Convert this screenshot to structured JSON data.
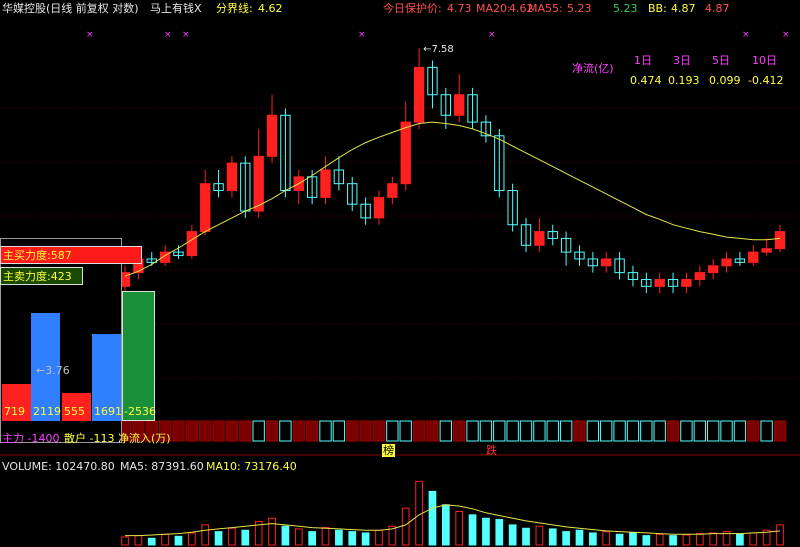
{
  "header": {
    "stock_name": "华媒控股(日线 前复权 对数)",
    "formula": "马上有钱X",
    "split_label": "分界线:",
    "split_value": "4.62",
    "protect_label": "今日保护价:",
    "protect_value": "4.73",
    "ma20_label": "MA20:",
    "ma20_value": "4.62",
    "ma55_label": "MA55:",
    "ma55_value": "5.23",
    "extra1": "5.23",
    "bb_label": "BB:",
    "bb_value": "4.87",
    "extra2": "4.87"
  },
  "netflow": {
    "title": "净流(亿)",
    "periods": [
      "1日",
      "3日",
      "5日",
      "10日"
    ],
    "values": [
      "0.474",
      "0.193",
      "0.099",
      "-0.412"
    ]
  },
  "force": {
    "buy_label": "主买力度:587",
    "sell_label": "主卖力度:423",
    "arrow_label": "←3.76",
    "bars": [
      {
        "label": "719",
        "value": 719,
        "color": "#ff2020"
      },
      {
        "label": "2119",
        "value": 2119,
        "color": "#2f7fff"
      },
      {
        "label": "555",
        "value": 555,
        "color": "#ff2020"
      },
      {
        "label": "1691",
        "value": 1691,
        "color": "#2f7fff"
      },
      {
        "label": "-2536",
        "value": 2536,
        "color": "#1a8f3a"
      }
    ],
    "bottom_main": "主力 -1400",
    "bottom_retail": "散户 -113",
    "bottom_net": "净流入(万)"
  },
  "markers": {
    "bang": "榜",
    "fall": "跌",
    "peak_label": "7.58"
  },
  "volume": {
    "title": "VOLUME: 102470.80",
    "ma5": "MA5: 87391.60",
    "ma10": "MA10: 73176.40"
  },
  "chart_data": {
    "type": "candlestick",
    "ma_line": [
      4.25,
      4.32,
      4.42,
      4.55,
      4.66,
      4.78,
      4.9,
      5.0,
      5.1,
      5.2,
      5.28,
      5.38,
      5.5,
      5.6,
      5.72,
      5.85,
      5.98,
      6.1,
      6.2,
      6.28,
      6.35,
      6.42,
      6.48,
      6.5,
      6.48,
      6.45,
      6.4,
      6.33,
      6.25,
      6.15,
      6.05,
      5.95,
      5.85,
      5.75,
      5.65,
      5.55,
      5.45,
      5.35,
      5.25,
      5.15,
      5.08,
      5.0,
      4.95,
      4.9,
      4.86,
      4.82,
      4.8,
      4.78,
      4.78,
      4.8
    ],
    "candles": [
      {
        "o": 4.1,
        "c": 4.3,
        "h": 4.4,
        "l": 4.0
      },
      {
        "o": 4.3,
        "c": 4.5,
        "h": 4.6,
        "l": 4.2
      },
      {
        "o": 4.5,
        "c": 4.45,
        "h": 4.6,
        "l": 4.4
      },
      {
        "o": 4.45,
        "c": 4.6,
        "h": 4.7,
        "l": 4.4
      },
      {
        "o": 4.6,
        "c": 4.55,
        "h": 4.7,
        "l": 4.5
      },
      {
        "o": 4.55,
        "c": 4.9,
        "h": 5.0,
        "l": 4.5
      },
      {
        "o": 4.9,
        "c": 5.6,
        "h": 5.8,
        "l": 4.85
      },
      {
        "o": 5.6,
        "c": 5.5,
        "h": 5.8,
        "l": 5.4
      },
      {
        "o": 5.5,
        "c": 5.9,
        "h": 6.0,
        "l": 5.4
      },
      {
        "o": 5.9,
        "c": 5.2,
        "h": 6.0,
        "l": 5.1
      },
      {
        "o": 5.2,
        "c": 6.0,
        "h": 6.4,
        "l": 5.1
      },
      {
        "o": 6.0,
        "c": 6.6,
        "h": 6.9,
        "l": 5.9
      },
      {
        "o": 6.6,
        "c": 5.5,
        "h": 6.7,
        "l": 5.4
      },
      {
        "o": 5.5,
        "c": 5.7,
        "h": 5.8,
        "l": 5.3
      },
      {
        "o": 5.7,
        "c": 5.4,
        "h": 5.8,
        "l": 5.3
      },
      {
        "o": 5.4,
        "c": 5.8,
        "h": 6.0,
        "l": 5.3
      },
      {
        "o": 5.8,
        "c": 5.6,
        "h": 6.0,
        "l": 5.5
      },
      {
        "o": 5.6,
        "c": 5.3,
        "h": 5.7,
        "l": 5.2
      },
      {
        "o": 5.3,
        "c": 5.1,
        "h": 5.4,
        "l": 5.0
      },
      {
        "o": 5.1,
        "c": 5.4,
        "h": 5.5,
        "l": 5.0
      },
      {
        "o": 5.4,
        "c": 5.6,
        "h": 5.7,
        "l": 5.3
      },
      {
        "o": 5.6,
        "c": 6.5,
        "h": 6.8,
        "l": 5.5
      },
      {
        "o": 6.5,
        "c": 7.3,
        "h": 7.58,
        "l": 6.4
      },
      {
        "o": 7.3,
        "c": 6.9,
        "h": 7.4,
        "l": 6.7
      },
      {
        "o": 6.9,
        "c": 6.6,
        "h": 7.0,
        "l": 6.4
      },
      {
        "o": 6.6,
        "c": 6.9,
        "h": 7.2,
        "l": 6.5
      },
      {
        "o": 6.9,
        "c": 6.5,
        "h": 7.0,
        "l": 6.4
      },
      {
        "o": 6.5,
        "c": 6.3,
        "h": 6.6,
        "l": 6.2
      },
      {
        "o": 6.3,
        "c": 5.5,
        "h": 6.4,
        "l": 5.4
      },
      {
        "o": 5.5,
        "c": 5.0,
        "h": 5.6,
        "l": 4.9
      },
      {
        "o": 5.0,
        "c": 4.7,
        "h": 5.1,
        "l": 4.6
      },
      {
        "o": 4.7,
        "c": 4.9,
        "h": 5.1,
        "l": 4.6
      },
      {
        "o": 4.9,
        "c": 4.8,
        "h": 5.0,
        "l": 4.7
      },
      {
        "o": 4.8,
        "c": 4.6,
        "h": 4.9,
        "l": 4.4
      },
      {
        "o": 4.6,
        "c": 4.5,
        "h": 4.7,
        "l": 4.4
      },
      {
        "o": 4.5,
        "c": 4.4,
        "h": 4.6,
        "l": 4.3
      },
      {
        "o": 4.4,
        "c": 4.5,
        "h": 4.6,
        "l": 4.3
      },
      {
        "o": 4.5,
        "c": 4.3,
        "h": 4.6,
        "l": 4.2
      },
      {
        "o": 4.3,
        "c": 4.2,
        "h": 4.4,
        "l": 4.1
      },
      {
        "o": 4.2,
        "c": 4.1,
        "h": 4.3,
        "l": 4.0
      },
      {
        "o": 4.1,
        "c": 4.2,
        "h": 4.3,
        "l": 4.0
      },
      {
        "o": 4.2,
        "c": 4.1,
        "h": 4.3,
        "l": 4.0
      },
      {
        "o": 4.1,
        "c": 4.2,
        "h": 4.3,
        "l": 4.0
      },
      {
        "o": 4.2,
        "c": 4.3,
        "h": 4.4,
        "l": 4.1
      },
      {
        "o": 4.3,
        "c": 4.4,
        "h": 4.5,
        "l": 4.2
      },
      {
        "o": 4.4,
        "c": 4.5,
        "h": 4.6,
        "l": 4.3
      },
      {
        "o": 4.5,
        "c": 4.45,
        "h": 4.6,
        "l": 4.4
      },
      {
        "o": 4.45,
        "c": 4.6,
        "h": 4.7,
        "l": 4.4
      },
      {
        "o": 4.6,
        "c": 4.65,
        "h": 4.8,
        "l": 4.55
      },
      {
        "o": 4.65,
        "c": 4.9,
        "h": 5.0,
        "l": 4.6
      }
    ],
    "strip": [
      "r",
      "r",
      "r",
      "r",
      "r",
      "r",
      "r",
      "r",
      "r",
      "r",
      "c",
      "r",
      "c",
      "r",
      "r",
      "c",
      "c",
      "r",
      "r",
      "r",
      "c",
      "c",
      "r",
      "r",
      "c",
      "r",
      "c",
      "c",
      "c",
      "c",
      "c",
      "c",
      "c",
      "c",
      "r",
      "c",
      "c",
      "c",
      "c",
      "c",
      "c",
      "r",
      "c",
      "c",
      "c",
      "c",
      "c",
      "r",
      "c",
      "r"
    ],
    "volume": [
      12,
      14,
      10,
      16,
      13,
      18,
      30,
      20,
      25,
      22,
      35,
      40,
      28,
      24,
      20,
      26,
      22,
      20,
      18,
      22,
      28,
      55,
      95,
      80,
      60,
      50,
      45,
      40,
      38,
      30,
      25,
      28,
      24,
      20,
      22,
      18,
      20,
      16,
      18,
      14,
      16,
      14,
      15,
      17,
      18,
      20,
      16,
      18,
      22,
      30
    ],
    "volume_ma": [
      14,
      14,
      15,
      16,
      17,
      19,
      22,
      24,
      26,
      28,
      30,
      32,
      30,
      28,
      26,
      25,
      24,
      23,
      22,
      22,
      24,
      30,
      45,
      55,
      60,
      58,
      54,
      48,
      44,
      40,
      36,
      33,
      30,
      27,
      25,
      23,
      21,
      20,
      19,
      18,
      17,
      16,
      16,
      16,
      17,
      17,
      17,
      18,
      19,
      21
    ]
  }
}
